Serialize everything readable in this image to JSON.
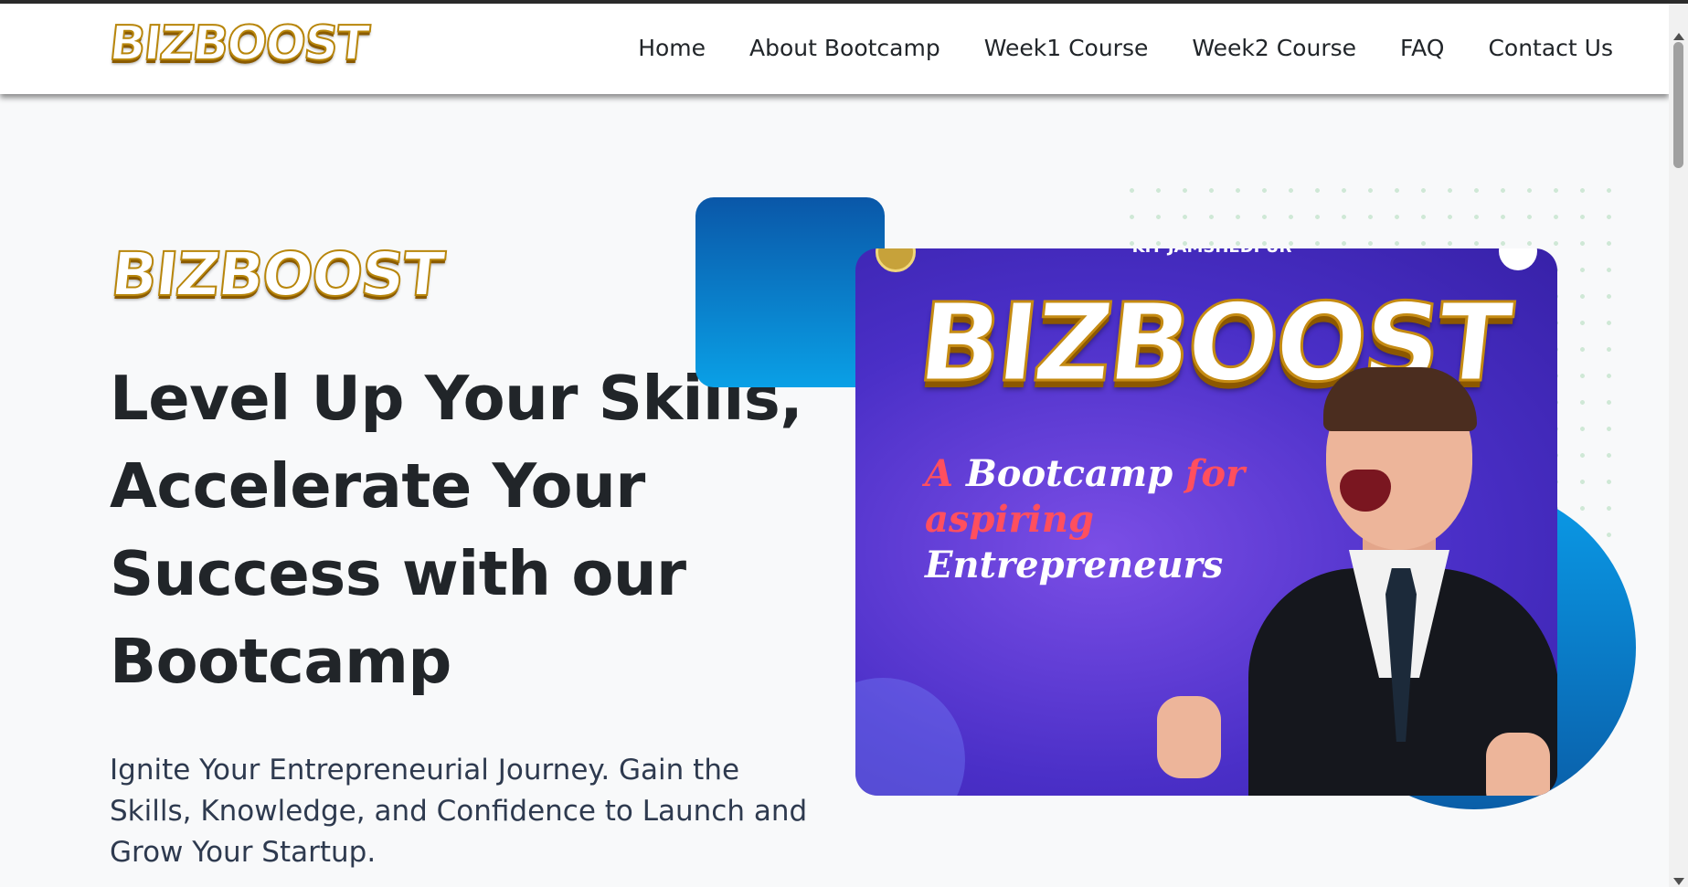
{
  "brand": {
    "logo_text": "BIZBOOST"
  },
  "nav": {
    "items": [
      {
        "label": "Home"
      },
      {
        "label": "About Bootcamp"
      },
      {
        "label": "Week1 Course"
      },
      {
        "label": "Week2 Course"
      },
      {
        "label": "FAQ"
      },
      {
        "label": "Contact Us"
      }
    ]
  },
  "hero": {
    "logo_text": "BIZBOOST",
    "title": "Level Up Your Skills, Accelerate Your Success with our Bootcamp",
    "subtitle": "Ignite Your Entrepreneurial Journey. Gain the Skills, Knowledge, and Confidence to Launch and Grow Your Startup."
  },
  "poster": {
    "top_text": "KIT JAMSHEDPUR",
    "logo_text": "BIZBOOST",
    "tagline": {
      "part1": "A ",
      "part2": "Bootcamp",
      "part3": " for ",
      "part4": "aspiring",
      "part5": "Entrepreneurs"
    }
  },
  "colors": {
    "brand_blue": "#0a6fc8",
    "poster_purple": "#4a2fc7",
    "accent_red": "#ff4f5e",
    "text_dark": "#212529"
  }
}
